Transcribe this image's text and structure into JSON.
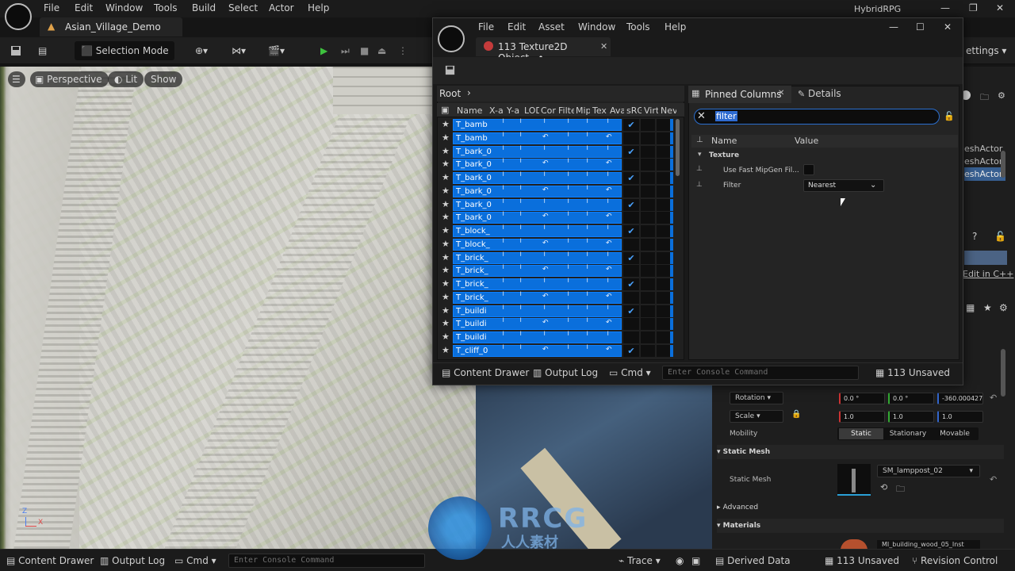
{
  "main_menu": [
    "File",
    "Edit",
    "Window",
    "Tools",
    "Build",
    "Select",
    "Actor",
    "Help"
  ],
  "project_name": "HybridRPG",
  "level_tab": "Asian_Village_Demo",
  "toolbar": {
    "selection_mode": "Selection Mode",
    "settings_partial": "ettings"
  },
  "viewport": {
    "perspective": "Perspective",
    "lit": "Lit",
    "show": "Show"
  },
  "outliner_partial": [
    "eshActor",
    "eshActor",
    "eshActor"
  ],
  "details_bg": {
    "edit_in_cpp": "Edit in C++",
    "rotation_label": "Rotation",
    "rotation": [
      "0.0 °",
      "0.0 °",
      "-360.000427"
    ],
    "scale_label": "Scale",
    "scale": [
      "1.0",
      "1.0",
      "1.0"
    ],
    "mobility_label": "Mobility",
    "mobility_options": [
      "Static",
      "Stationary",
      "Movable"
    ],
    "static_mesh_section": "Static Mesh",
    "static_mesh_label": "Static Mesh",
    "static_mesh_value": "SM_lamppost_02",
    "advanced": "Advanced",
    "materials": "Materials",
    "material_partial": "MI_building_wood_05_Inst"
  },
  "bottom_bar": {
    "content_drawer": "Content Drawer",
    "output_log": "Output Log",
    "cmd": "Cmd",
    "console_placeholder": "Enter Console Command",
    "trace": "Trace",
    "derived_data": "Derived Data",
    "unsaved": "113 Unsaved",
    "revision_control": "Revision Control"
  },
  "window": {
    "menu": [
      "File",
      "Edit",
      "Asset",
      "Window",
      "Tools",
      "Help"
    ],
    "tab_title": "113 Texture2D Object...•",
    "breadcrumb": "Root",
    "columns": [
      "Name",
      "X-a",
      "Y-a",
      "LOD",
      "Cor",
      "Filte",
      "Mip",
      "Tex",
      "Ava",
      "sRG",
      "Virt",
      "Nev"
    ],
    "rows": [
      {
        "name": "T_bamb",
        "checked": true
      },
      {
        "name": "T_bamb",
        "checked": false
      },
      {
        "name": "T_bark_0",
        "checked": true
      },
      {
        "name": "T_bark_0",
        "checked": false
      },
      {
        "name": "T_bark_0",
        "checked": true
      },
      {
        "name": "T_bark_0",
        "checked": false
      },
      {
        "name": "T_bark_0",
        "checked": true
      },
      {
        "name": "T_bark_0",
        "checked": false
      },
      {
        "name": "T_block_",
        "checked": true
      },
      {
        "name": "T_block_",
        "checked": false
      },
      {
        "name": "T_brick_",
        "checked": true
      },
      {
        "name": "T_brick_",
        "checked": false
      },
      {
        "name": "T_brick_",
        "checked": true
      },
      {
        "name": "T_brick_",
        "checked": false
      },
      {
        "name": "T_buildi",
        "checked": true
      },
      {
        "name": "T_buildi",
        "checked": false
      },
      {
        "name": "T_buildi",
        "checked": false
      },
      {
        "name": "T_cliff_0",
        "checked": true
      }
    ],
    "pinned_tab": "Pinned Columns",
    "details_tab": "Details",
    "filter_value": "filter",
    "name_col": "Name",
    "value_col": "Value",
    "category": "Texture",
    "prop1": "Use Fast MipGen Fil...",
    "prop2": "Filter",
    "filter_dropdown": "Nearest",
    "bottom": {
      "content_drawer": "Content Drawer",
      "output_log": "Output Log",
      "cmd": "Cmd",
      "console_placeholder": "Enter Console Command",
      "unsaved": "113 Unsaved"
    }
  },
  "watermark": {
    "line1": "RRCG",
    "line2": "人人素材"
  },
  "colors": {
    "selection_blue": "#0a6fdc",
    "accent_green": "#3ec23e"
  }
}
